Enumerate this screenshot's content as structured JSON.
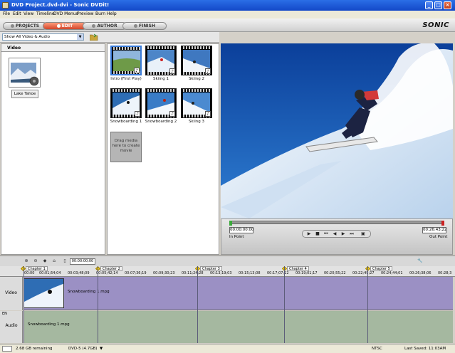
{
  "window": {
    "title": "DVD Project.dvd-dvi - Sonic DVDit!"
  },
  "menu": [
    "File",
    "Edit",
    "View",
    "Timeline",
    "DVD Menus",
    "Preview",
    "Burn",
    "Help"
  ],
  "modes": [
    "PROJECTS",
    "EDIT",
    "AUTHOR",
    "FINISH"
  ],
  "brand": "SONIC",
  "filter": {
    "selected": "Show All Video & Audio"
  },
  "left_panel": {
    "header": "Video",
    "item_label": "Lake Tahoe"
  },
  "clips": [
    {
      "caption": "Intro (First Play)"
    },
    {
      "caption": "Skiing 1"
    },
    {
      "caption": "Skiing 2"
    },
    {
      "caption": "Snowboarding 1"
    },
    {
      "caption": "Snowboarding 2"
    },
    {
      "caption": "Skiing 3"
    }
  ],
  "drop_hint": "Drag media here to create movie",
  "preview": {
    "in_time": "00:00:00:00",
    "out_time": "00:26:43;22",
    "in_label": "In Point",
    "out_label": "Out Point"
  },
  "timeline": {
    "timecode": "00:00:00;00",
    "chapters": [
      "Chapter 1",
      "Chapter 2",
      "Chapter 3",
      "Chapter 4",
      "Chapter 5"
    ],
    "ticks": [
      "00:00",
      "00:01;54;04",
      "00:03;48;09",
      "00:05;42;14",
      "00:07;36;19",
      "00:09;30;23",
      "00:11;24;28",
      "00:13;19;03",
      "00:15;13;08",
      "00:17;07;12",
      "00:19;01;17",
      "00:20;55;22",
      "00:22;49;27",
      "00:24;44;01",
      "00:26;38;06",
      "00:28;3"
    ],
    "tracks": {
      "video_label": "Video",
      "audio_label": "Audio",
      "lang": "EN",
      "video_clip": "Snowboarding 1.mpg",
      "audio_clip": "Snowboarding 1.mpg"
    }
  },
  "status": {
    "remaining": "2.68 GB remaining",
    "disc": "DVD-5 (4.7GB)",
    "format": "NTSC",
    "saved": "Last Saved: 11:03AM"
  }
}
